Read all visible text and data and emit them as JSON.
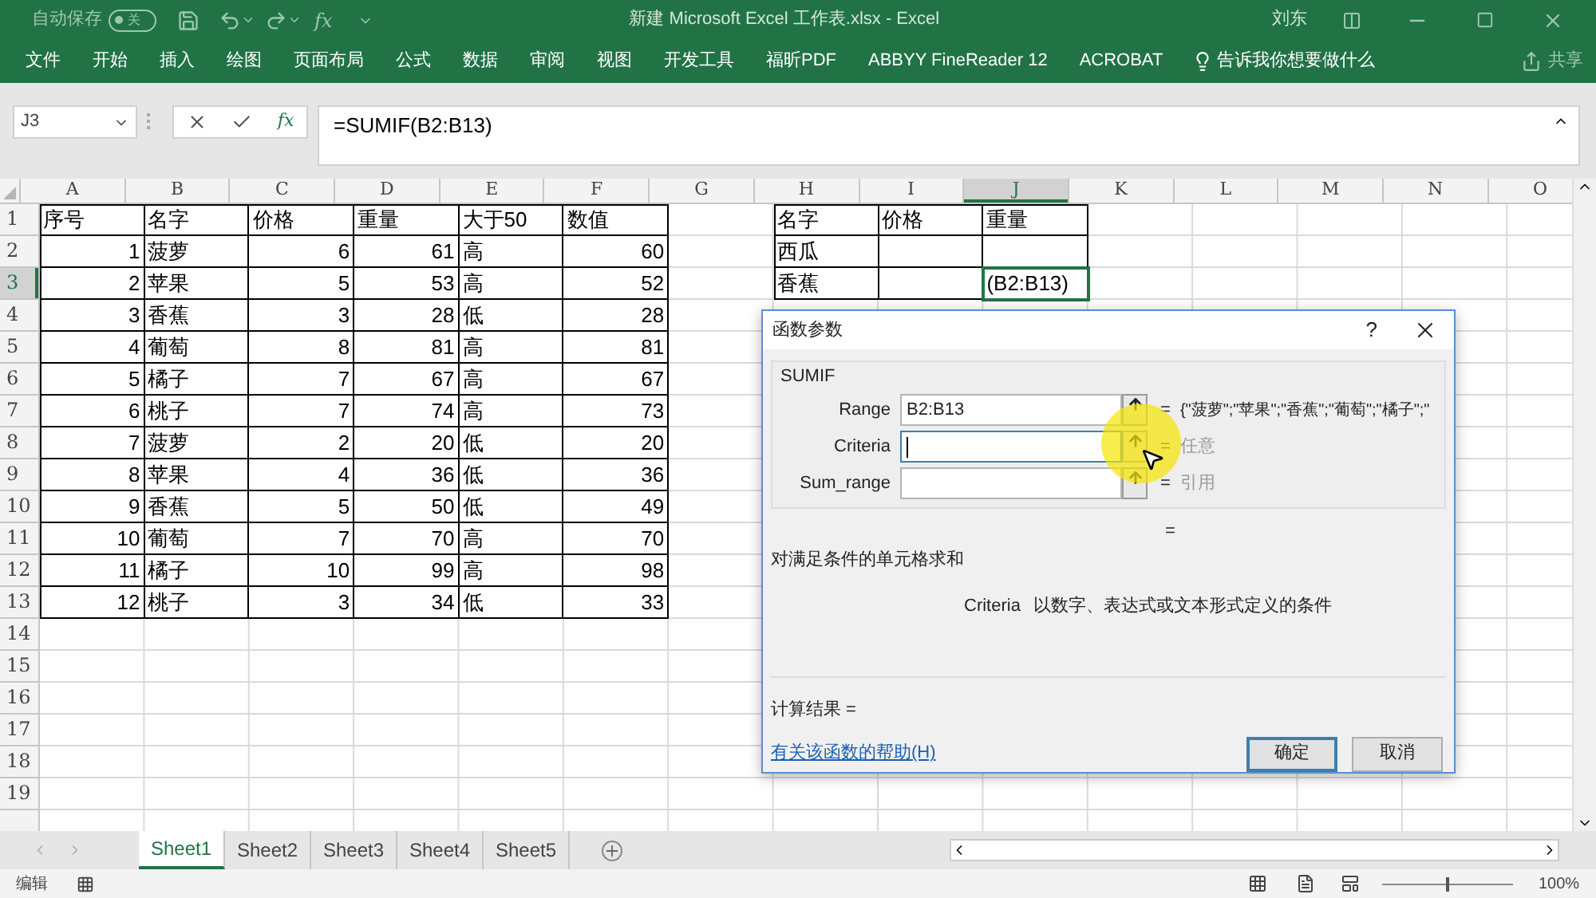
{
  "title_bar": {
    "autosave_label": "自动保存",
    "autosave": {
      "on": false,
      "label": "关"
    },
    "qat_fx": "fx",
    "title": "新建 Microsoft Excel 工作表.xlsx  -  Excel",
    "user": "刘东"
  },
  "ribbon": {
    "tabs": [
      "文件",
      "开始",
      "插入",
      "绘图",
      "页面布局",
      "公式",
      "数据",
      "审阅",
      "视图",
      "开发工具",
      "福昕PDF",
      "ABBYY FineReader 12",
      "ACROBAT"
    ],
    "tell_me": "告诉我你想要做什么",
    "share": "共享"
  },
  "formula_bar": {
    "name_box": "J3",
    "fx": "fx",
    "formula": "=SUMIF(B2:B13)"
  },
  "sheet": {
    "columns": [
      {
        "label": "A",
        "selected": false
      },
      {
        "label": "B",
        "selected": false
      },
      {
        "label": "C",
        "selected": false
      },
      {
        "label": "D",
        "selected": false
      },
      {
        "label": "E",
        "selected": false
      },
      {
        "label": "F",
        "selected": false
      },
      {
        "label": "G",
        "selected": false
      },
      {
        "label": "H",
        "selected": false
      },
      {
        "label": "I",
        "selected": false
      },
      {
        "label": "J",
        "selected": true
      },
      {
        "label": "K",
        "selected": false
      },
      {
        "label": "L",
        "selected": false
      },
      {
        "label": "M",
        "selected": false
      },
      {
        "label": "N",
        "selected": false
      },
      {
        "label": "O",
        "selected": false
      }
    ],
    "rows": [
      {
        "number": "1",
        "selected": false,
        "cells": [
          {
            "kind": "text",
            "text": "序号"
          },
          {
            "kind": "text",
            "text": "名字"
          },
          {
            "kind": "text",
            "text": "价格"
          },
          {
            "kind": "text",
            "text": "重量"
          },
          {
            "kind": "text",
            "text": "大于50"
          },
          {
            "kind": "text",
            "text": "数值"
          },
          {
            "kind": "plain"
          },
          {
            "kind": "text",
            "text": "名字"
          },
          {
            "kind": "text",
            "text": "价格"
          },
          {
            "kind": "text",
            "text": "重量"
          }
        ]
      },
      {
        "number": "2",
        "selected": false,
        "cells": [
          {
            "kind": "number",
            "text": "1"
          },
          {
            "kind": "text",
            "text": "菠萝"
          },
          {
            "kind": "number",
            "text": "6"
          },
          {
            "kind": "number",
            "text": "61"
          },
          {
            "kind": "text",
            "text": "高"
          },
          {
            "kind": "number",
            "text": "60"
          },
          {
            "kind": "plain"
          },
          {
            "kind": "text",
            "text": "西瓜"
          },
          {
            "kind": "empty"
          },
          {
            "kind": "empty"
          }
        ]
      },
      {
        "number": "3",
        "selected": true,
        "cells": [
          {
            "kind": "number",
            "text": "2"
          },
          {
            "kind": "text",
            "text": "苹果"
          },
          {
            "kind": "number",
            "text": "5"
          },
          {
            "kind": "number",
            "text": "53"
          },
          {
            "kind": "text",
            "text": "高"
          },
          {
            "kind": "number",
            "text": "52"
          },
          {
            "kind": "plain"
          },
          {
            "kind": "text",
            "text": "香蕉"
          },
          {
            "kind": "empty"
          },
          {
            "kind": "editing",
            "text": "(B2:B13)"
          }
        ]
      },
      {
        "number": "4",
        "selected": false,
        "cells": [
          {
            "kind": "number",
            "text": "3"
          },
          {
            "kind": "text",
            "text": "香蕉"
          },
          {
            "kind": "number",
            "text": "3"
          },
          {
            "kind": "number",
            "text": "28"
          },
          {
            "kind": "text",
            "text": "低"
          },
          {
            "kind": "number",
            "text": "28"
          }
        ]
      },
      {
        "number": "5",
        "selected": false,
        "cells": [
          {
            "kind": "number",
            "text": "4"
          },
          {
            "kind": "text",
            "text": "葡萄"
          },
          {
            "kind": "number",
            "text": "8"
          },
          {
            "kind": "number",
            "text": "81"
          },
          {
            "kind": "text",
            "text": "高"
          },
          {
            "kind": "number",
            "text": "81"
          }
        ]
      },
      {
        "number": "6",
        "selected": false,
        "cells": [
          {
            "kind": "number",
            "text": "5"
          },
          {
            "kind": "text",
            "text": "橘子"
          },
          {
            "kind": "number",
            "text": "7"
          },
          {
            "kind": "number",
            "text": "67"
          },
          {
            "kind": "text",
            "text": "高"
          },
          {
            "kind": "number",
            "text": "67"
          }
        ]
      },
      {
        "number": "7",
        "selected": false,
        "cells": [
          {
            "kind": "number",
            "text": "6"
          },
          {
            "kind": "text",
            "text": "桃子"
          },
          {
            "kind": "number",
            "text": "7"
          },
          {
            "kind": "number",
            "text": "74"
          },
          {
            "kind": "text",
            "text": "高"
          },
          {
            "kind": "number",
            "text": "73"
          }
        ]
      },
      {
        "number": "8",
        "selected": false,
        "cells": [
          {
            "kind": "number",
            "text": "7"
          },
          {
            "kind": "text",
            "text": "菠萝"
          },
          {
            "kind": "number",
            "text": "2"
          },
          {
            "kind": "number",
            "text": "20"
          },
          {
            "kind": "text",
            "text": "低"
          },
          {
            "kind": "number",
            "text": "20"
          }
        ]
      },
      {
        "number": "9",
        "selected": false,
        "cells": [
          {
            "kind": "number",
            "text": "8"
          },
          {
            "kind": "text",
            "text": "苹果"
          },
          {
            "kind": "number",
            "text": "4"
          },
          {
            "kind": "number",
            "text": "36"
          },
          {
            "kind": "text",
            "text": "低"
          },
          {
            "kind": "number",
            "text": "36"
          }
        ]
      },
      {
        "number": "10",
        "selected": false,
        "cells": [
          {
            "kind": "number",
            "text": "9"
          },
          {
            "kind": "text",
            "text": "香蕉"
          },
          {
            "kind": "number",
            "text": "5"
          },
          {
            "kind": "number",
            "text": "50"
          },
          {
            "kind": "text",
            "text": "低"
          },
          {
            "kind": "number",
            "text": "49"
          }
        ]
      },
      {
        "number": "11",
        "selected": false,
        "cells": [
          {
            "kind": "number",
            "text": "10"
          },
          {
            "kind": "text",
            "text": "葡萄"
          },
          {
            "kind": "number",
            "text": "7"
          },
          {
            "kind": "number",
            "text": "70"
          },
          {
            "kind": "text",
            "text": "高"
          },
          {
            "kind": "number",
            "text": "70"
          }
        ]
      },
      {
        "number": "12",
        "selected": false,
        "cells": [
          {
            "kind": "number",
            "text": "11"
          },
          {
            "kind": "text",
            "text": "橘子"
          },
          {
            "kind": "number",
            "text": "10"
          },
          {
            "kind": "number",
            "text": "99"
          },
          {
            "kind": "text",
            "text": "高"
          },
          {
            "kind": "number",
            "text": "98"
          }
        ]
      },
      {
        "number": "13",
        "selected": false,
        "cells": [
          {
            "kind": "number",
            "text": "12"
          },
          {
            "kind": "text",
            "text": "桃子"
          },
          {
            "kind": "number",
            "text": "3"
          },
          {
            "kind": "number",
            "text": "34"
          },
          {
            "kind": "text",
            "text": "低"
          },
          {
            "kind": "number",
            "text": "33"
          }
        ]
      },
      {
        "number": "14",
        "selected": false
      },
      {
        "number": "15",
        "selected": false
      },
      {
        "number": "16",
        "selected": false
      },
      {
        "number": "17",
        "selected": false
      },
      {
        "number": "18",
        "selected": false
      },
      {
        "number": "19",
        "selected": false
      }
    ]
  },
  "dialog": {
    "title": "函数参数",
    "help": "?",
    "function_name": "SUMIF",
    "arguments": [
      {
        "label": "Range",
        "value": "B2:B13",
        "focused": false,
        "equals": "=",
        "result": "{\"菠萝\";\"苹果\";\"香蕉\";\"葡萄\";\"橘子\";\"",
        "dimmed": false
      },
      {
        "label": "Criteria",
        "focused": true,
        "equals": "=",
        "result": "任意",
        "dimmed": true
      },
      {
        "label": "Sum_range",
        "focused": false,
        "equals": "=",
        "result": "引用",
        "dimmed": true
      }
    ],
    "function_equals": "=",
    "description": "对满足条件的单元格求和",
    "arg_help_name": "Criteria",
    "arg_help_text": "以数字、表达式或文本形式定义的条件",
    "result_label": "计算结果 =",
    "help_link": "有关该函数的帮助(H)",
    "buttons": [
      {
        "label": "确定",
        "default": true
      },
      {
        "label": "取消",
        "default": false
      }
    ]
  },
  "sheet_tabs": [
    {
      "label": "Sheet1",
      "selected": true
    },
    {
      "label": "Sheet2",
      "selected": false
    },
    {
      "label": "Sheet3",
      "selected": false
    },
    {
      "label": "Sheet4",
      "selected": false
    },
    {
      "label": "Sheet5",
      "selected": false
    }
  ],
  "status_bar": {
    "mode": "编辑",
    "zoom_slider": {
      "level": 0.5
    },
    "zoom": "100%"
  }
}
